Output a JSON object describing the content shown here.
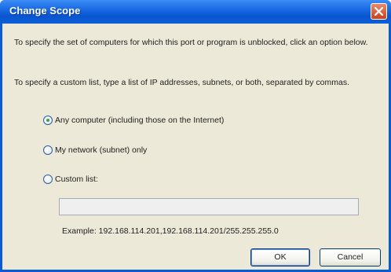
{
  "window": {
    "title": "Change Scope"
  },
  "description": {
    "line1": "To specify the set of computers for which this port or program is unblocked, click an option below.",
    "line2": "To specify a custom list, type a list of IP addresses, subnets, or both, separated by commas."
  },
  "options": [
    {
      "label": "Any computer (including those on the Internet)",
      "checked": true
    },
    {
      "label": "My network (subnet) only",
      "checked": false
    },
    {
      "label": "Custom list:",
      "checked": false
    }
  ],
  "custom_list": {
    "value": "",
    "example": "Example: 192.168.114.201,192.168.114.201/255.255.255.0"
  },
  "buttons": {
    "ok": "OK",
    "cancel": "Cancel"
  },
  "colors": {
    "titlebar": "#0a55cf",
    "dialog_bg": "#ece9d8",
    "close_button": "#c9421e"
  },
  "icons": {
    "close": "close-icon"
  }
}
